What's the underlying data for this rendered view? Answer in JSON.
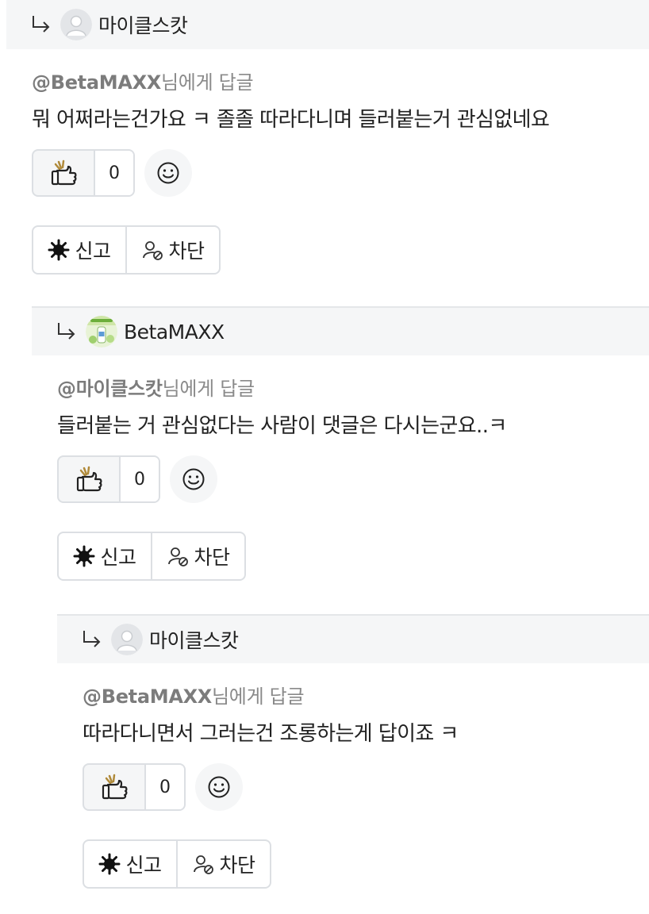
{
  "comments": [
    {
      "author": "마이클스캇",
      "mention_user": "@BetaMAXX",
      "mention_suffix": "님에게 답글",
      "text": "뭐 어쩌라는건가요 ㅋ 졸졸 따라다니며 들러붙는거 관심없네요",
      "like_count": "0",
      "report_label": "신고",
      "block_label": "차단",
      "avatar": "default-user"
    },
    {
      "author": "BetaMAXX",
      "mention_user": "@마이클스캇",
      "mention_suffix": "님에게 답글",
      "text": "들러붙는 거 관심없다는 사람이 댓글은 다시는군요..ㅋ",
      "like_count": "0",
      "report_label": "신고",
      "block_label": "차단",
      "avatar": "green-product-image"
    },
    {
      "author": "마이클스캇",
      "mention_user": "@BetaMAXX",
      "mention_suffix": "님에게 답글",
      "text": "따라다니면서 그러는건 조롱하는게 답이죠 ㅋ",
      "like_count": "0",
      "report_label": "신고",
      "block_label": "차단",
      "avatar": "default-user"
    }
  ],
  "icons": {
    "reply": "reply-arrow-icon",
    "like": "thumbs-up-icon",
    "emoji": "smiley-icon",
    "report": "siren-icon",
    "block": "user-block-icon"
  },
  "colors": {
    "header_bg": "#f5f6f7",
    "border": "#dcdfe3",
    "muted_text": "#8a8a8a",
    "text": "#222222"
  }
}
